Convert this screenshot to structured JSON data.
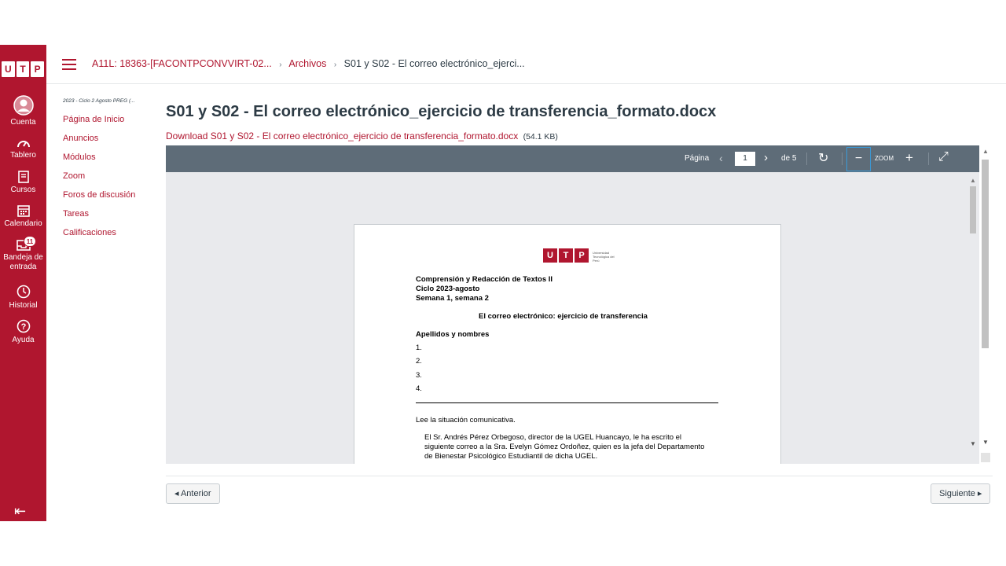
{
  "global_nav": {
    "logo_letters": [
      "U",
      "T",
      "P"
    ],
    "items": [
      {
        "label": "Cuenta",
        "icon": "account-icon"
      },
      {
        "label": "Tablero",
        "icon": "dashboard-icon"
      },
      {
        "label": "Cursos",
        "icon": "courses-icon"
      },
      {
        "label": "Calendario",
        "icon": "calendar-icon"
      },
      {
        "label": "Bandeja de entrada",
        "icon": "inbox-icon",
        "badge": "11"
      },
      {
        "label": "Historial",
        "icon": "history-icon"
      },
      {
        "label": "Ayuda",
        "icon": "help-icon"
      }
    ],
    "collapse_glyph": "⇤",
    "brand_color": "#b0162f"
  },
  "breadcrumb": {
    "course": "A11L: 18363-[FACONTPCONVVIRT-02...",
    "section": "Archivos",
    "current": "S01 y S02 - El correo electrónico_ejerci...",
    "separator": "›"
  },
  "course_nav": {
    "term": "2023 - Ciclo 2 Agosto PREG (...",
    "items": [
      "Página de Inicio",
      "Anuncios",
      "Módulos",
      "Zoom",
      "Foros de discusión",
      "Tareas",
      "Calificaciones"
    ]
  },
  "file": {
    "title": "S01 y S02 - El correo electrónico_ejercicio de transferencia_formato.docx",
    "download_label": "Download S01 y S02 - El correo electrónico_ejercicio de transferencia_formato.docx",
    "size": "(54.1 KB)"
  },
  "viewer": {
    "page_label": "Página",
    "current_page": "1",
    "of_label": "de 5",
    "zoom_label": "ZOOM",
    "prev_glyph": "‹",
    "next_glyph": "›",
    "rotate_glyph": "↻",
    "zoom_out_glyph": "−",
    "zoom_in_glyph": "+",
    "fullscreen_glyph": "⤢"
  },
  "document": {
    "logo_letters": [
      "U",
      "T",
      "P"
    ],
    "logo_caption": "Universidad Tecnológica del Perú",
    "course": "Comprensión y Redacción de Textos II",
    "cycle": "Ciclo 2023-agosto",
    "weeks": "Semana 1, semana 2",
    "heading": "El correo electrónico: ejercicio de transferencia",
    "names_label": "Apellidos y nombres",
    "numbers": [
      "1.",
      "2.",
      "3.",
      "4."
    ],
    "instruction": "Lee la situación comunicativa.",
    "paragraph_lines": [
      "El Sr. Andrés Pérez Orbegoso, director de la UGEL Huancayo, le ha escrito el",
      "siguiente correo a la Sra. Evelyn Gómez Ordoñez, quien es la jefa del Departamento",
      "de Bienestar Psicológico Estudiantil de dicha UGEL."
    ]
  },
  "footer": {
    "prev_label": "◂ Anterior",
    "next_label": "Siguiente ▸"
  }
}
